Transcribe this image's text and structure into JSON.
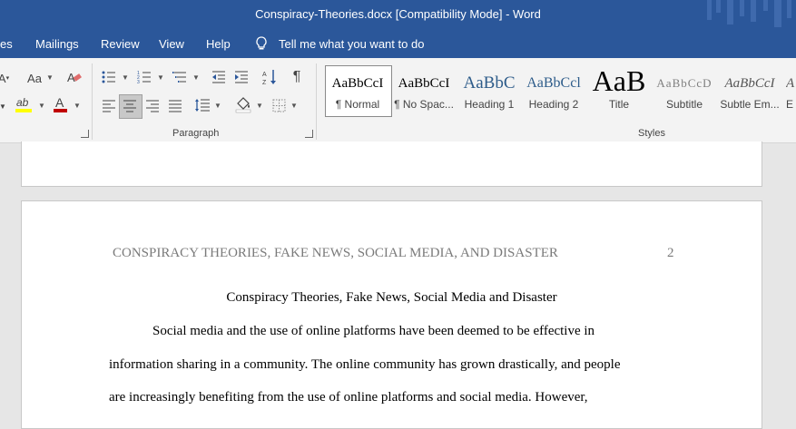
{
  "window": {
    "title": "Conspiracy-Theories.docx [Compatibility Mode]  -  Word"
  },
  "menu": {
    "items": [
      "es",
      "Mailings",
      "Review",
      "View",
      "Help"
    ],
    "tell_me": "Tell me what you want to do"
  },
  "ribbon": {
    "font": {
      "aa_label": "Aa"
    },
    "paragraph": {
      "label": "Paragraph"
    },
    "styles": {
      "label": "Styles",
      "items": [
        {
          "sample": "AaBbCcI",
          "name": "¶ Normal"
        },
        {
          "sample": "AaBbCcI",
          "name": "¶ No Spac..."
        },
        {
          "sample": "AaBbC",
          "name": "Heading 1"
        },
        {
          "sample": "AaBbCcl",
          "name": "Heading 2"
        },
        {
          "sample": "AaB",
          "name": "Title"
        },
        {
          "sample": "AaBbCcD",
          "name": "Subtitle"
        },
        {
          "sample": "AaBbCcI",
          "name": "Subtle Em..."
        },
        {
          "sample": "A",
          "name": "E"
        }
      ]
    },
    "colors": {
      "highlight": "#ffff00",
      "font_color": "#c00000",
      "accent": "#2b579a"
    }
  },
  "document": {
    "running_head": "CONSPIRACY THEORIES, FAKE NEWS, SOCIAL MEDIA, AND DISASTER",
    "page_number": "2",
    "title": "Conspiracy Theories, Fake News, Social Media and Disaster",
    "lines": [
      "Social media and the use of online platforms have been deemed to be effective in",
      "information sharing in a community. The online community has grown drastically, and people",
      "are increasingly benefiting from the use of online platforms and social media. However,"
    ]
  }
}
